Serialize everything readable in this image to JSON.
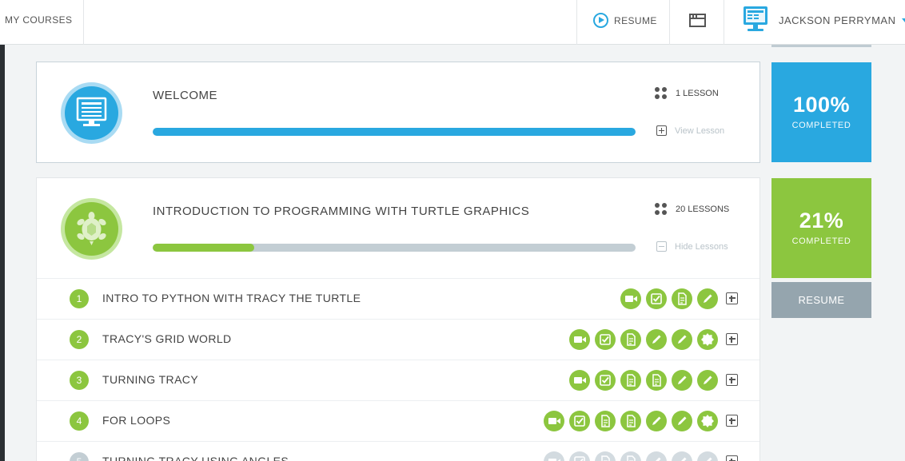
{
  "topbar": {
    "my_courses": "MY COURSES",
    "resume": "RESUME",
    "user_name": "JACKSON PERRYMAN"
  },
  "modules": [
    {
      "title": "WELCOME",
      "lesson_count": "1 LESSON",
      "toggle_label": "View Lesson",
      "progress": 1.0,
      "percent": "100%",
      "completed_label": "COMPLETED",
      "color": "#29a8e0",
      "icon": "computer-monitor-icon"
    },
    {
      "title": "INTRODUCTION TO PROGRAMMING WITH TURTLE GRAPHICS",
      "lesson_count": "20 LESSONS",
      "toggle_label": "Hide Lessons",
      "progress": 0.21,
      "percent": "21%",
      "completed_label": "COMPLETED",
      "resume_label": "RESUME",
      "color": "#8cc63f",
      "icon": "turtle-icon",
      "lessons": [
        {
          "number": "1",
          "title": "INTRO TO PYTHON WITH TRACY THE TURTLE",
          "status": "unlocked",
          "activities": [
            "video",
            "check",
            "doc",
            "pencil"
          ]
        },
        {
          "number": "2",
          "title": "TRACY'S GRID WORLD",
          "status": "unlocked",
          "activities": [
            "video",
            "check",
            "doc",
            "pencil",
            "pencil",
            "badge"
          ]
        },
        {
          "number": "3",
          "title": "TURNING TRACY",
          "status": "unlocked",
          "activities": [
            "video",
            "check",
            "doc",
            "doc",
            "pencil",
            "pencil"
          ]
        },
        {
          "number": "4",
          "title": "FOR LOOPS",
          "status": "unlocked",
          "activities": [
            "video",
            "check",
            "doc",
            "doc",
            "pencil",
            "pencil",
            "badge"
          ]
        },
        {
          "number": "5",
          "title": "TURNING TRACY USING ANGLES",
          "status": "locked",
          "activities": [
            "video",
            "check",
            "doc",
            "doc",
            "pencil",
            "pencil",
            "pencil"
          ]
        }
      ]
    }
  ]
}
